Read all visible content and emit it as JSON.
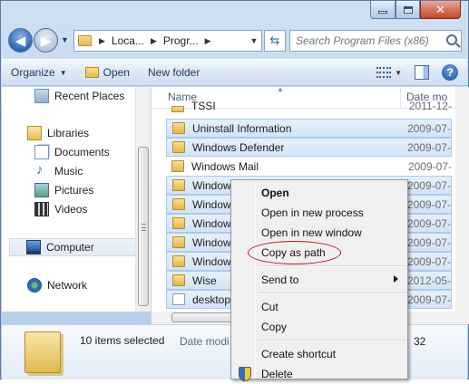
{
  "navbar": {
    "breadcrumbs": [
      "Loca...",
      "Progr..."
    ],
    "search_placeholder": "Search Program Files (x86)"
  },
  "toolbar": {
    "organize": "Organize",
    "open": "Open",
    "new_folder": "New folder"
  },
  "nav_pane": {
    "items": [
      {
        "label": "Recent Places",
        "icon": "recent-places-icon"
      },
      {
        "label": "Libraries",
        "icon": "libraries-icon"
      },
      {
        "label": "Documents",
        "icon": "documents-icon"
      },
      {
        "label": "Music",
        "icon": "music-icon"
      },
      {
        "label": "Pictures",
        "icon": "pictures-icon"
      },
      {
        "label": "Videos",
        "icon": "videos-icon"
      },
      {
        "label": "Computer",
        "icon": "computer-icon"
      },
      {
        "label": "Network",
        "icon": "network-icon"
      }
    ]
  },
  "file_list": {
    "columns": {
      "name": "Name",
      "date": "Date mo"
    },
    "rows": [
      {
        "name": "TSSI",
        "date": "2011-12-",
        "selected": false
      },
      {
        "name": "Uninstall Information",
        "date": "2009-07-",
        "selected": true
      },
      {
        "name": "Windows Defender",
        "date": "2009-07-",
        "selected": true
      },
      {
        "name": "Windows Mail",
        "date": "2009-07-",
        "selected": false
      },
      {
        "name": "Windows",
        "date": "2009-07-",
        "selected": true
      },
      {
        "name": "Windows",
        "date": "2009-07-",
        "selected": true
      },
      {
        "name": "Windows",
        "date": "2009-07-",
        "selected": true
      },
      {
        "name": "Windows",
        "date": "2009-07-",
        "selected": true
      },
      {
        "name": "Windows",
        "date": "2009-07-",
        "selected": true
      },
      {
        "name": "Wise",
        "date": "2012-05-",
        "selected": true
      },
      {
        "name": "desktop.",
        "date": "2009-07-",
        "selected": true
      }
    ]
  },
  "details": {
    "count": "10 items selected",
    "label": "Date modi",
    "value": "32"
  },
  "context_menu": {
    "items": {
      "open": "Open",
      "open_new_process": "Open in new process",
      "open_new_window": "Open in new window",
      "copy_as_path": "Copy as path",
      "send_to": "Send to",
      "cut": "Cut",
      "copy": "Copy",
      "create_shortcut": "Create shortcut",
      "delete": "Delete"
    }
  },
  "colors": {
    "highlight_ellipse": "#c0141e",
    "selection": "#d2e4f7"
  }
}
